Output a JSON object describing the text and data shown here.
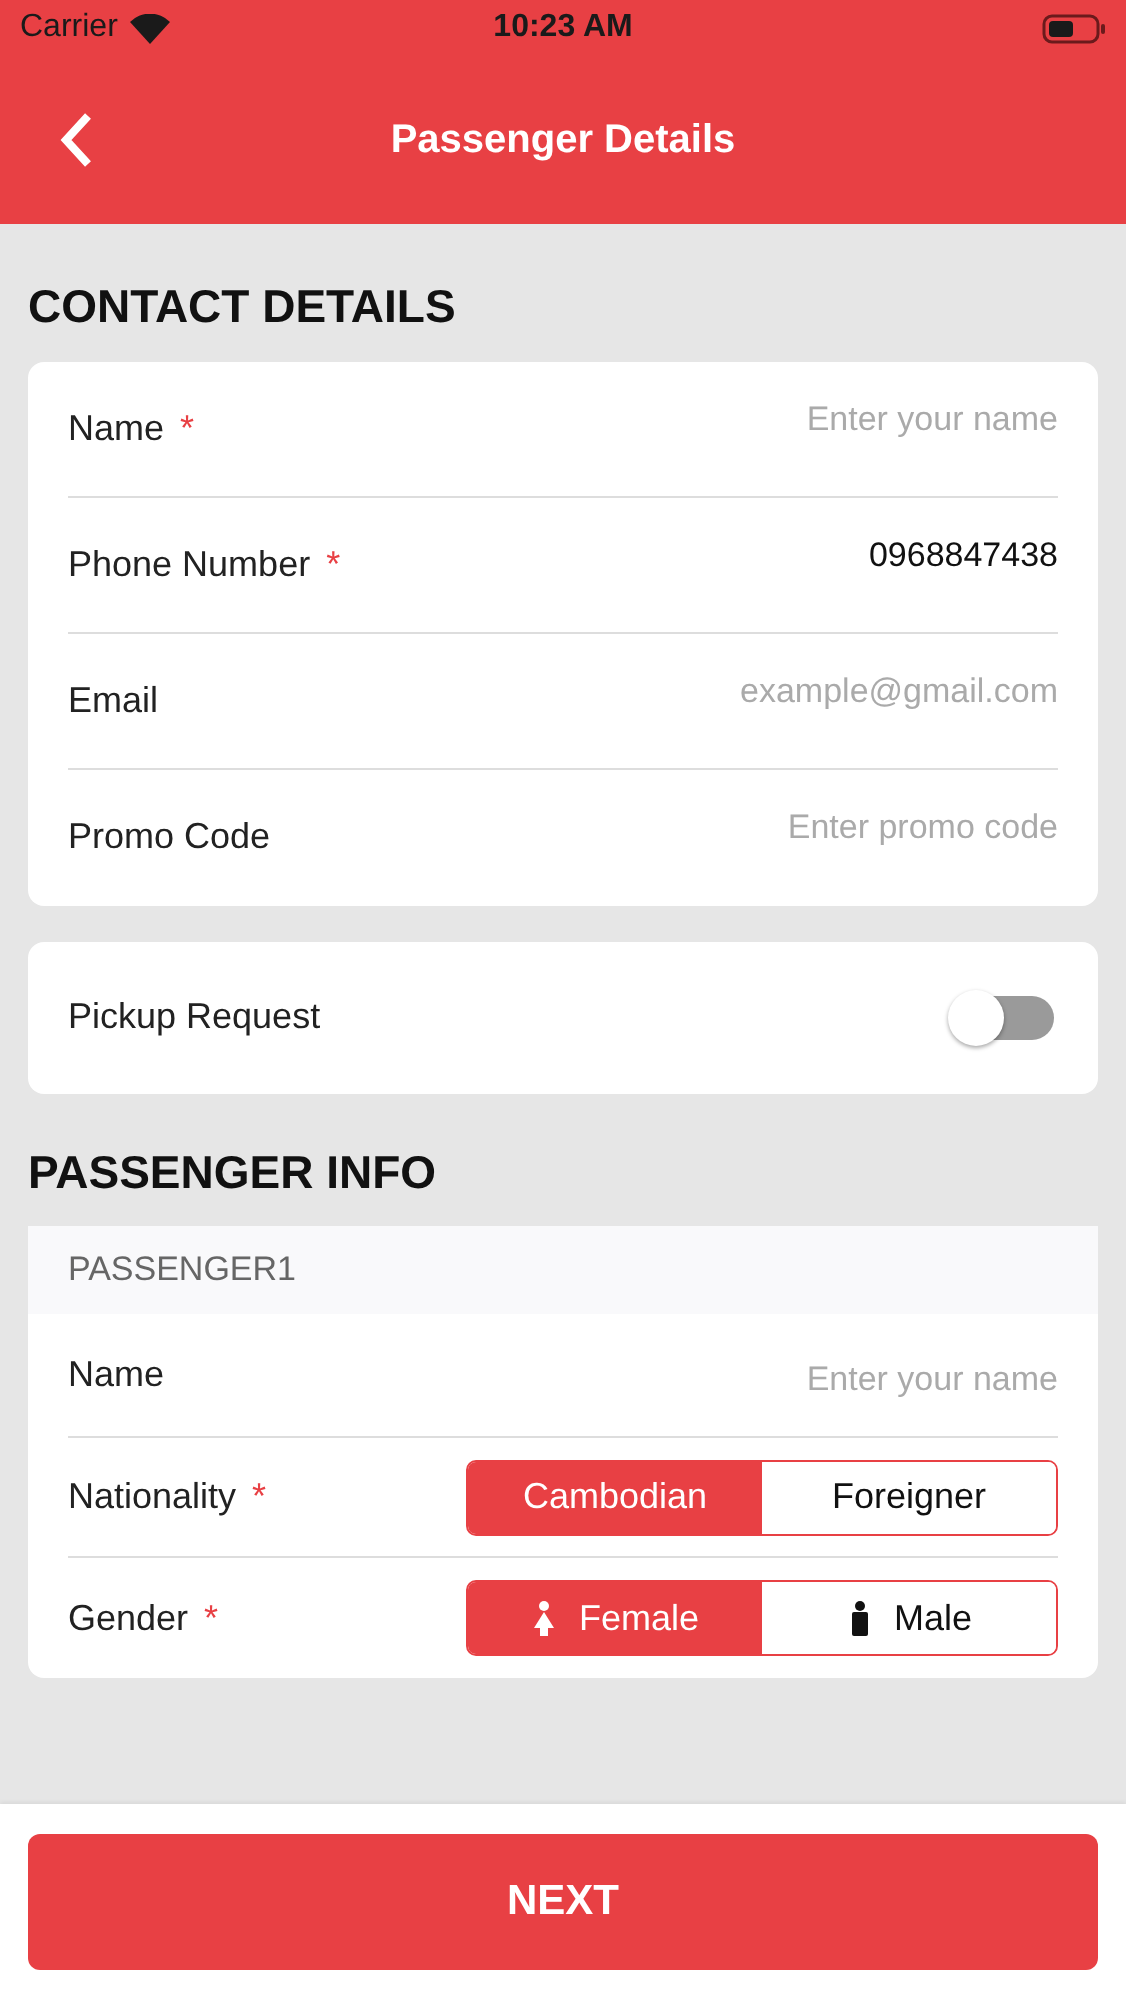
{
  "status_bar": {
    "carrier": "Carrier",
    "time": "10:23 AM"
  },
  "header": {
    "title": "Passenger Details"
  },
  "contact": {
    "heading": "CONTACT DETAILS",
    "fields": [
      {
        "label": "Name",
        "required_mark": "*",
        "placeholder": "Enter your name"
      },
      {
        "label": "Phone Number",
        "required_mark": "*",
        "value": "0968847438"
      },
      {
        "label": "Email",
        "placeholder": "example@gmail.com"
      },
      {
        "label": "Promo Code",
        "placeholder": "Enter promo code"
      }
    ]
  },
  "pickup": {
    "label": "Pickup Request",
    "on": false
  },
  "passenger_info": {
    "heading": "PASSENGER INFO",
    "passengers": [
      {
        "title": "PASSENGER1",
        "name": {
          "label": "Name",
          "placeholder": "Enter your name"
        },
        "rows": [
          {
            "label": "Nationality",
            "required_mark": "*",
            "options": [
              {
                "label": "Cambodian",
                "kind": "text",
                "selected": true
              },
              {
                "label": "Foreigner",
                "kind": "text",
                "selected": false
              }
            ]
          },
          {
            "label": "Gender",
            "required_mark": "*",
            "options": [
              {
                "label": "Female",
                "kind": "woman",
                "selected": true
              },
              {
                "label": "Male",
                "kind": "man",
                "selected": false
              }
            ]
          }
        ]
      }
    ]
  },
  "footer": {
    "button": "NEXT"
  }
}
